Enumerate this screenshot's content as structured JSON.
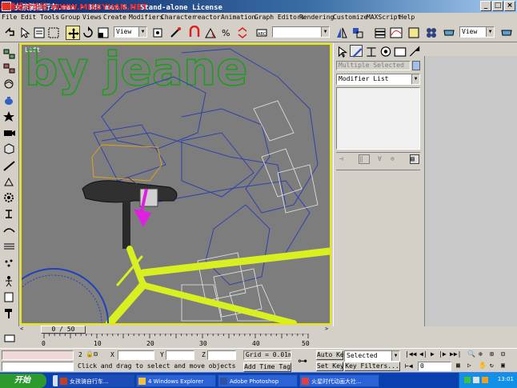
{
  "window": {
    "title": "女孩骑自行车.max - 3ds max 6 - Stand-alone License",
    "watermark": "思缘设计论坛 WWW.MISSYUAN.NET"
  },
  "menu": [
    "File",
    "Edit",
    "Tools",
    "Group",
    "Views",
    "Create",
    "Modifiers",
    "Character",
    "reactor",
    "Animation",
    "Graph Editors",
    "Rendering",
    "Customize",
    "MAXScript",
    "Help"
  ],
  "toolbar": {
    "refcoord": "View",
    "named_selection": "",
    "view_right": "View"
  },
  "viewport": {
    "label": "Left",
    "watermark_text": "by jeane"
  },
  "command_panel": {
    "name_field": "Multiple Selected",
    "modifier_list": "Modifier List"
  },
  "timeline": {
    "frame_display": "0 / 50",
    "ticks": [
      "0",
      "10",
      "20",
      "30",
      "40",
      "50"
    ]
  },
  "status": {
    "selected_count": "2",
    "x_label": "X",
    "y_label": "Y",
    "z_label": "Z",
    "grid": "Grid = 0.01m",
    "prompt": "Click and drag to select and move objects",
    "add_time_tag": "Add Time Tag",
    "auto_key": "Auto Key",
    "set_key": "Set Key",
    "key_mode": "Selected",
    "key_filters": "Key Filters...",
    "frame_field": "0"
  },
  "taskbar": {
    "start": "开始",
    "tasks": [
      "女孩骑自行车...",
      "4 Windows Explorer",
      "Adobe Photoshop",
      "火星时代动画大社..."
    ],
    "clock": "13:01"
  },
  "colors": {
    "viewport_bg": "#7d7d7d",
    "active_border": "#e8e800",
    "bike_frame": "#d8f020",
    "selection_arrow": "#e020e0"
  }
}
